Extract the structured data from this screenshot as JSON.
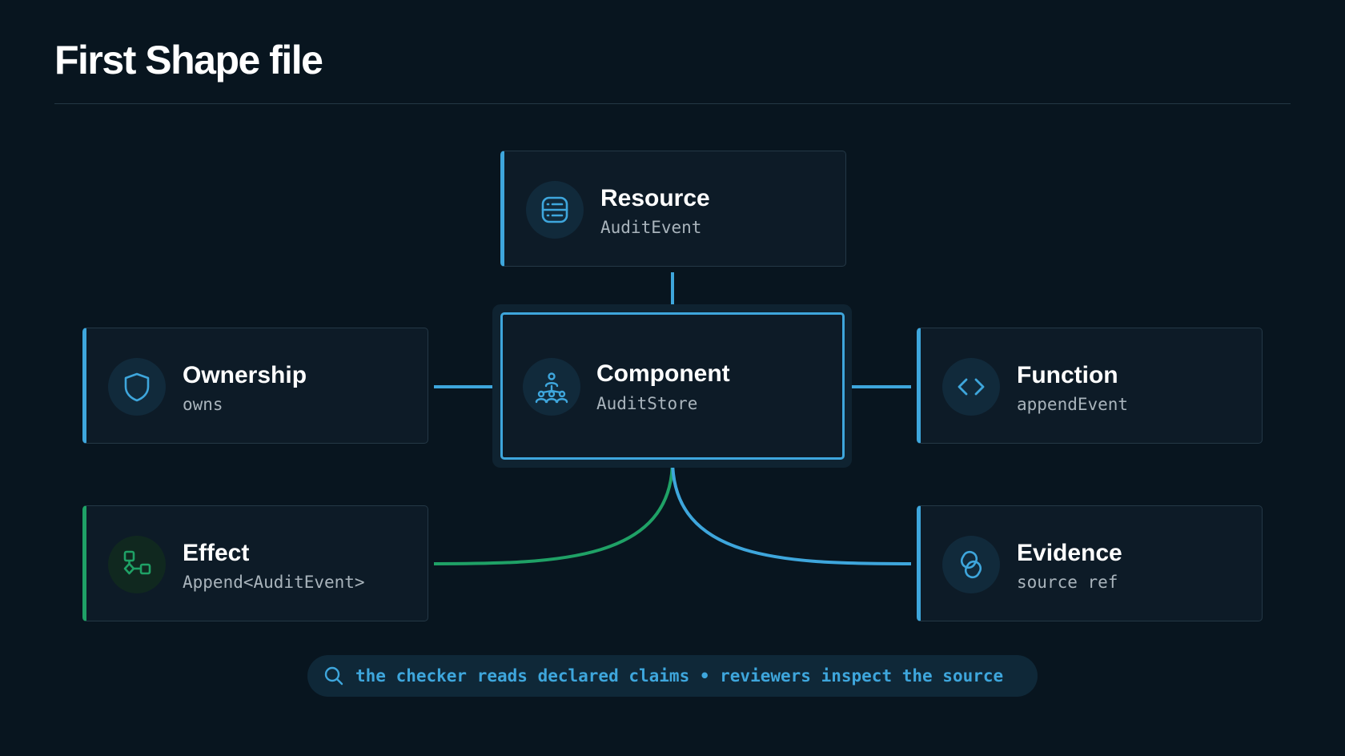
{
  "title": "First Shape file",
  "colors": {
    "blue": "#3ea6dc",
    "green": "#1fa166",
    "background": "#08151f",
    "card": "#0d1b27"
  },
  "nodes": {
    "resource": {
      "name": "Resource",
      "sub": "AuditEvent",
      "icon": "server-icon"
    },
    "ownership": {
      "name": "Ownership",
      "sub": "owns",
      "icon": "shield-icon"
    },
    "component": {
      "name": "Component",
      "sub": "AuditStore",
      "icon": "hierarchy-icon"
    },
    "function": {
      "name": "Function",
      "sub": "appendEvent",
      "icon": "code-icon"
    },
    "effect": {
      "name": "Effect",
      "sub": "Append<AuditEvent>",
      "icon": "workflow-icon"
    },
    "evidence": {
      "name": "Evidence",
      "sub": "source ref",
      "icon": "link-icon"
    }
  },
  "callout": {
    "text": "the checker reads declared claims • reviewers inspect the source",
    "icon": "search-icon"
  }
}
